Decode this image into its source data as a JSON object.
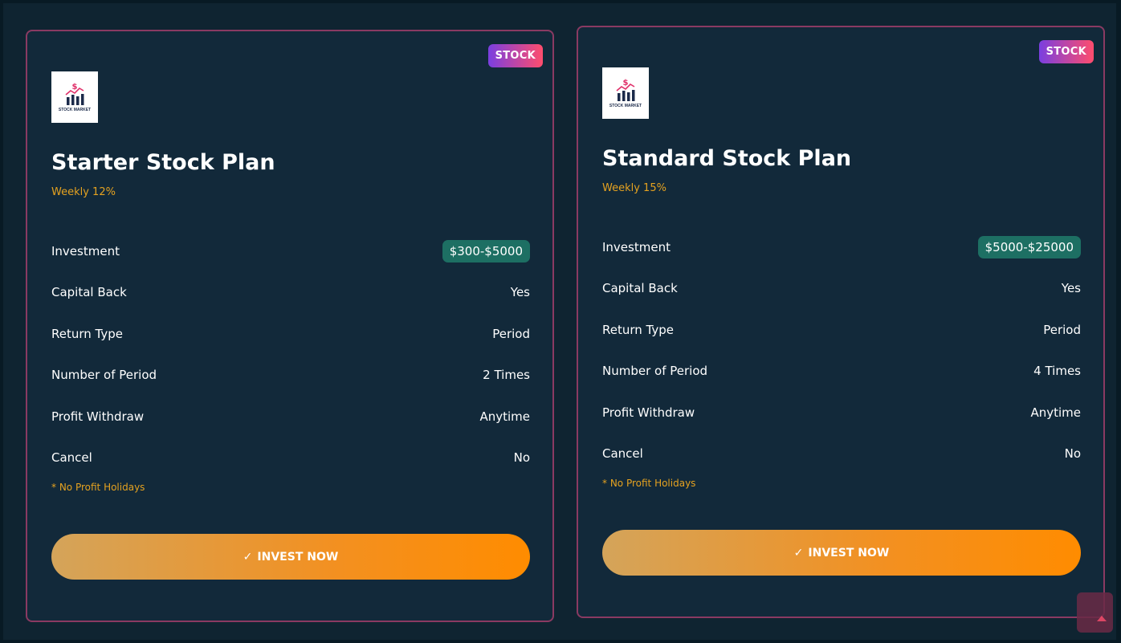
{
  "plans": [
    {
      "badge": "STOCK",
      "logo_text": "STOCK MARKET",
      "title": "Starter Stock Plan",
      "subtitle": "Weekly 12%",
      "rows": [
        {
          "label": "Investment",
          "value": "$300-$5000"
        },
        {
          "label": "Capital Back",
          "value": "Yes"
        },
        {
          "label": "Return Type",
          "value": "Period"
        },
        {
          "label": "Number of Period",
          "value": "2 Times"
        },
        {
          "label": "Profit Withdraw",
          "value": "Anytime"
        },
        {
          "label": "Cancel",
          "value": "No"
        }
      ],
      "note": "* No Profit Holidays",
      "cta_label": "INVEST NOW"
    },
    {
      "badge": "STOCK",
      "logo_text": "STOCK MARKET",
      "title": "Standard Stock Plan",
      "subtitle": "Weekly 15%",
      "rows": [
        {
          "label": "Investment",
          "value": "$5000-$25000"
        },
        {
          "label": "Capital Back",
          "value": "Yes"
        },
        {
          "label": "Return Type",
          "value": "Period"
        },
        {
          "label": "Number of Period",
          "value": "4 Times"
        },
        {
          "label": "Profit Withdraw",
          "value": "Anytime"
        },
        {
          "label": "Cancel",
          "value": "No"
        }
      ],
      "note": "* No Profit Holidays",
      "cta_label": "INVEST NOW"
    }
  ],
  "icons": {
    "check": "check-icon",
    "scroll_top": "arrow-up-icon",
    "logo": "stock-market-logo-icon"
  },
  "colors": {
    "background": "#0f2431",
    "card_border": "#8a3a62",
    "accent_gold": "#e5a220",
    "pill_green": "#1d6f63",
    "badge_gradient_start": "#7a3fe0",
    "badge_gradient_end": "#ff4d6d",
    "cta_gradient_start": "#d4a45a",
    "cta_gradient_end": "#ff8c00"
  }
}
